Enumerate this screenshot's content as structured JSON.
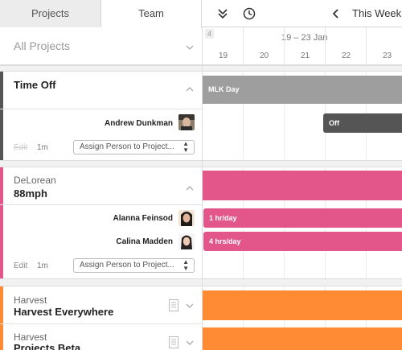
{
  "tabs": {
    "projects": "Projects",
    "team": "Team"
  },
  "toolbar": {
    "week_label": "This Week",
    "icons": [
      "collapse-all-icon",
      "clock-icon",
      "chevron-left-icon"
    ]
  },
  "left_header": {
    "filter_label": "All Projects"
  },
  "calendar": {
    "week_number": "4",
    "range": "19 – 23 Jan",
    "days": [
      "19",
      "20",
      "21",
      "22",
      "23"
    ]
  },
  "colors": {
    "time_off": "#9e9e9e",
    "time_off_person": "#555555",
    "delorean": "#e2568a",
    "harvest": "#ff8b34"
  },
  "groups": {
    "time_off": {
      "title": "Time Off",
      "bar_label": "MLK Day",
      "person": {
        "name": "Andrew Dunkman",
        "bar_label": "Off"
      },
      "edit": "Edit",
      "duration": "1m",
      "assign_placeholder": "Assign Person to Project..."
    },
    "delorean": {
      "client": "DeLorean",
      "title": "88mph",
      "people": [
        {
          "name": "Alanna Feinsod",
          "bar_label": "1 hr/day"
        },
        {
          "name": "Calina Madden",
          "bar_label": "4 hrs/day"
        }
      ],
      "edit": "Edit",
      "duration": "1m",
      "assign_placeholder": "Assign Person to Project..."
    },
    "harvest_everywhere": {
      "client": "Harvest",
      "title": "Harvest Everywhere"
    },
    "projects_beta": {
      "client": "Harvest",
      "title": "Projects Beta"
    }
  }
}
